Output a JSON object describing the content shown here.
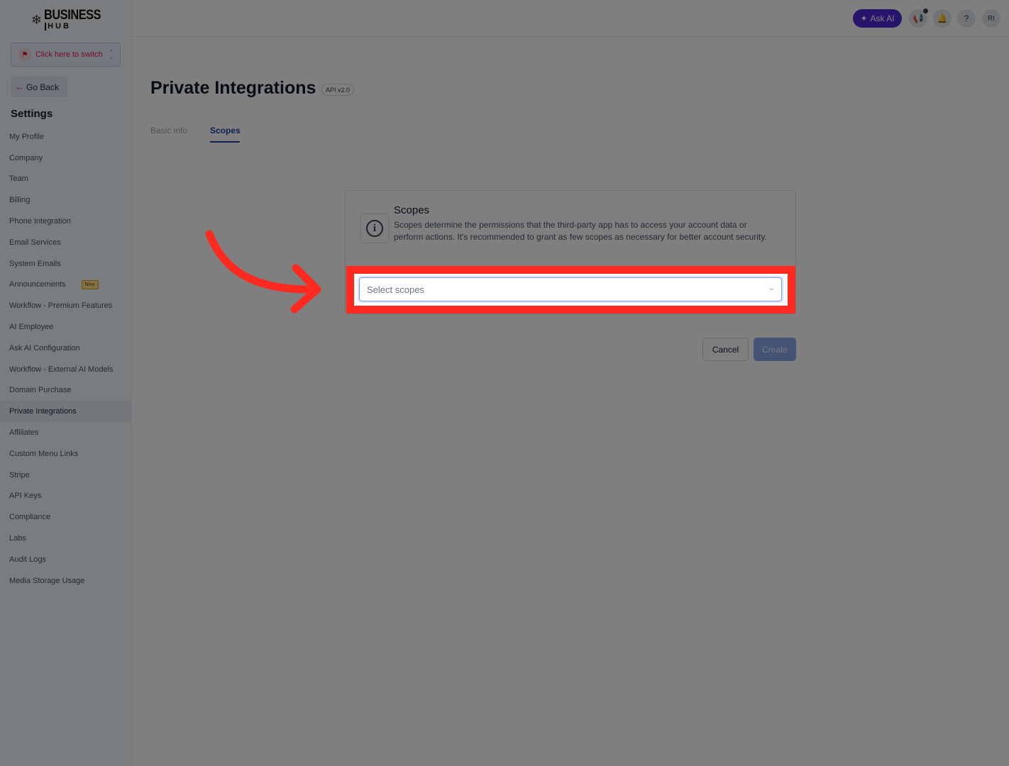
{
  "brand": {
    "line1": "BUSINESS",
    "line2": "HUB"
  },
  "switcher": {
    "label": "Click here to switch"
  },
  "go_back": {
    "label": "Go Back"
  },
  "sidebar": {
    "title": "Settings",
    "items": [
      {
        "label": "My Profile"
      },
      {
        "label": "Company"
      },
      {
        "label": "Team"
      },
      {
        "label": "Billing"
      },
      {
        "label": "Phone Integration"
      },
      {
        "label": "Email Services"
      },
      {
        "label": "System Emails"
      },
      {
        "label": "Announcements",
        "badge": "New"
      },
      {
        "label": "Workflow - Premium Features"
      },
      {
        "label": "AI Employee"
      },
      {
        "label": "Ask AI Configuration"
      },
      {
        "label": "Workflow - External AI Models"
      },
      {
        "label": "Domain Purchase"
      },
      {
        "label": "Private Integrations",
        "active": true
      },
      {
        "label": "Affiliates"
      },
      {
        "label": "Custom Menu Links"
      },
      {
        "label": "Stripe"
      },
      {
        "label": "API Keys"
      },
      {
        "label": "Compliance"
      },
      {
        "label": "Labs"
      },
      {
        "label": "Audit Logs"
      },
      {
        "label": "Media Storage Usage"
      }
    ]
  },
  "topbar": {
    "ask_ai": "Ask AI",
    "help": "?",
    "avatar": "RI",
    "icons": [
      "megaphone-icon",
      "bell-icon",
      "help-icon"
    ]
  },
  "page": {
    "title": "Private Integrations",
    "api_badge": "API v2.0",
    "tabs": [
      {
        "label": "Basic info",
        "active": false
      },
      {
        "label": "Scopes",
        "active": true
      }
    ]
  },
  "scopes_card": {
    "title": "Scopes",
    "description": "Scopes determine the permissions that the third-party app has to access your account data or perform actions. It's recommended to grant as few scopes as necessary for better account security.",
    "select_placeholder": "Select scopes"
  },
  "actions": {
    "cancel": "Cancel",
    "create": "Create"
  },
  "colors": {
    "highlight": "#ff2a1f",
    "accent": "#1e40af",
    "ask_ai": "#4f2bd9"
  }
}
